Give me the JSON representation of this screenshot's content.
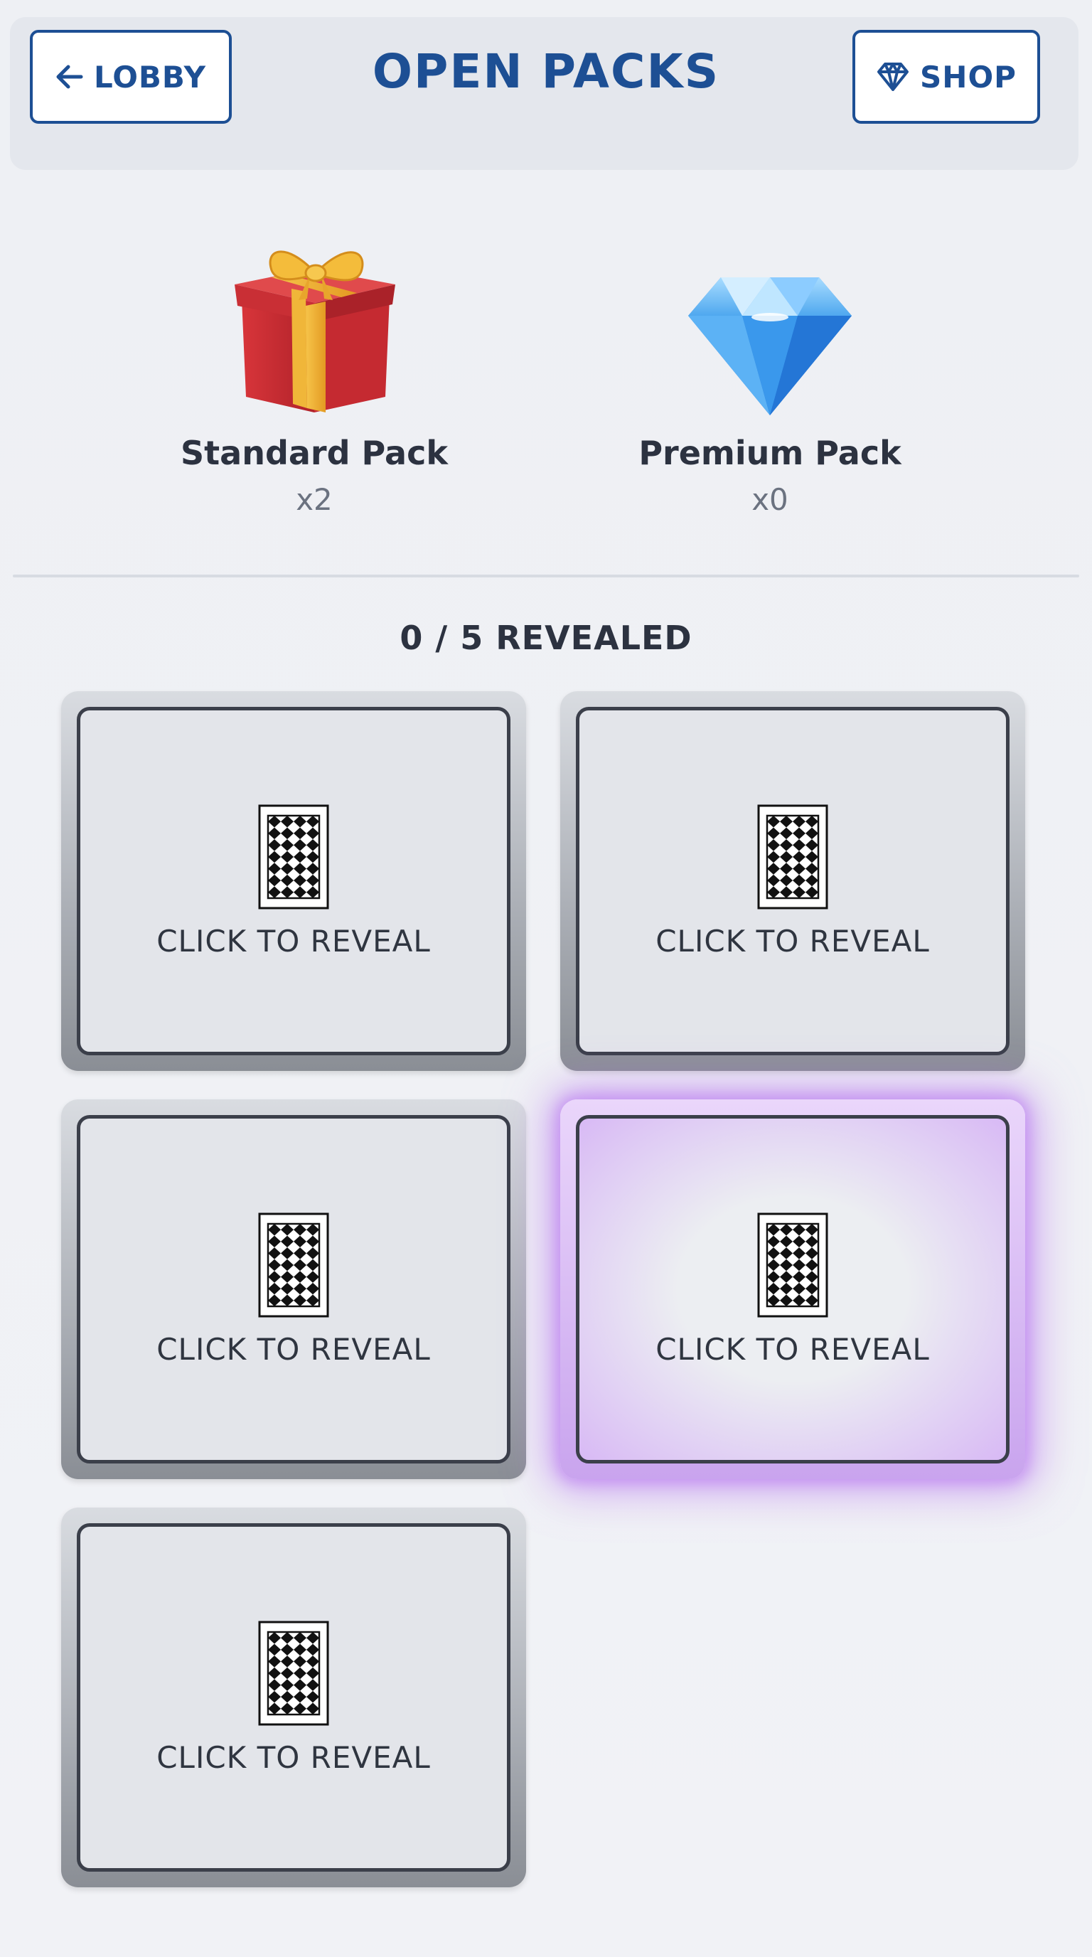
{
  "header": {
    "title": "OPEN PACKS",
    "lobby_label": "LOBBY",
    "shop_label": "SHOP"
  },
  "packs": [
    {
      "name": "Standard Pack",
      "count": "x2",
      "icon": "gift-box-icon"
    },
    {
      "name": "Premium Pack",
      "count": "x0",
      "icon": "diamond-icon"
    }
  ],
  "reveal_status": "0 / 5 REVEALED",
  "cards": [
    {
      "label": "CLICK TO REVEAL",
      "highlighted": false
    },
    {
      "label": "CLICK TO REVEAL",
      "highlighted": false
    },
    {
      "label": "CLICK TO REVEAL",
      "highlighted": false
    },
    {
      "label": "CLICK TO REVEAL",
      "highlighted": true
    },
    {
      "label": "CLICK TO REVEAL",
      "highlighted": false
    }
  ],
  "colors": {
    "accent": "#1d4f94",
    "highlight_glow": "#b46ef0",
    "background": "#eef0f4"
  }
}
